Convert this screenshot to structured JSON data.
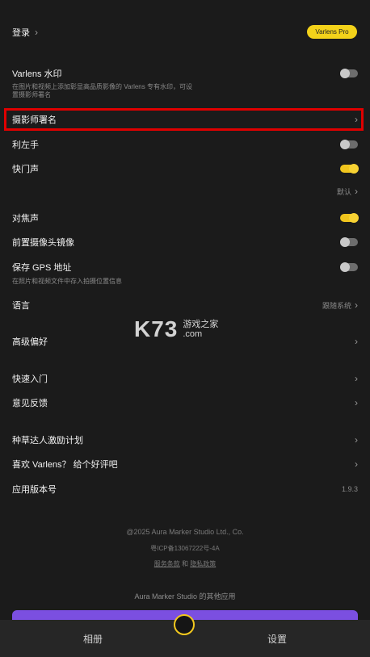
{
  "header": {
    "login_label": "登录",
    "pro_label": "Varlens Pro"
  },
  "settings": {
    "watermark": {
      "label": "Varlens 水印",
      "desc": "在图片和视频上添加彰显高品质影像的 Varlens 专有水印，可设置摄影师署名"
    },
    "photographer": {
      "label": "摄影师署名"
    },
    "left_hand": {
      "label": "利左手"
    },
    "shutter_sound": {
      "label": "快门声",
      "default_label": "默认"
    },
    "focus_sound": {
      "label": "对焦声"
    },
    "front_mirror": {
      "label": "前置摄像头镜像"
    },
    "gps": {
      "label": "保存 GPS 地址",
      "desc": "在照片和视频文件中存入拍摄位置信息"
    },
    "language": {
      "label": "语言",
      "value": "跟随系统"
    },
    "advanced": {
      "label": "高级偏好"
    },
    "quick_start": {
      "label": "快速入门"
    },
    "feedback": {
      "label": "意见反馈"
    },
    "seed_plan": {
      "label": "种草达人激励计划"
    },
    "rate": {
      "label": "喜欢 Varlens？ 给个好评吧"
    },
    "version": {
      "label": "应用版本号",
      "value": "1.9.3"
    }
  },
  "toggles": {
    "watermark": false,
    "left_hand": false,
    "shutter_sound": true,
    "focus_sound": true,
    "front_mirror": false,
    "gps": false
  },
  "footer": {
    "copyright": "@2025 Aura Marker Studio Ltd., Co.",
    "icp": "粤ICP备13067222号-4A",
    "terms": "服务条款",
    "and": "和",
    "privacy": "隐私政策",
    "other_apps": "Aura Marker Studio 的其他应用"
  },
  "watermark_logo": {
    "big": "K73",
    "line1": "游戏之家",
    "line2": ".com"
  },
  "tabs": {
    "album": "相册",
    "settings": "设置"
  },
  "colors": {
    "accent": "#f3d21a",
    "highlight": "#e00000",
    "purple": "#7b4fe0"
  }
}
